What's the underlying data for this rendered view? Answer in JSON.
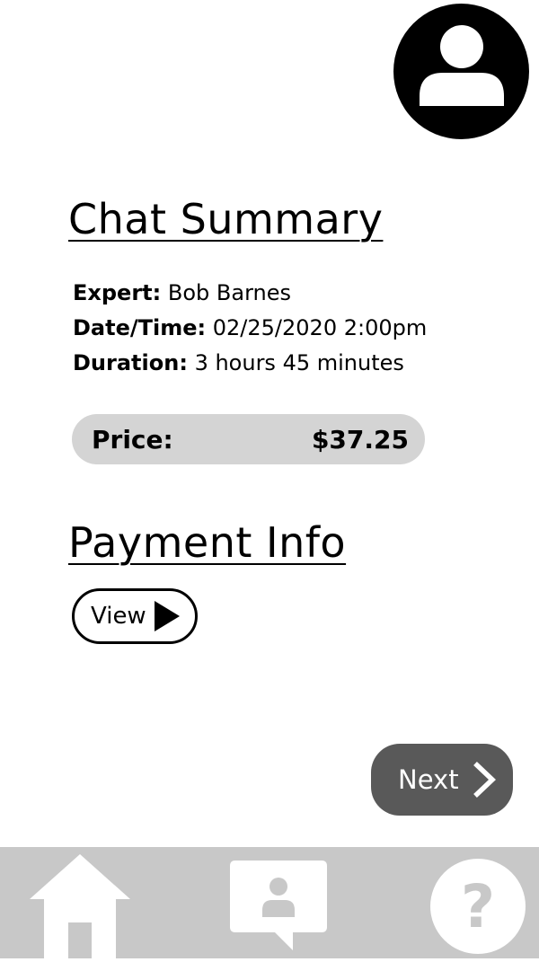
{
  "header": {
    "profile_icon": "user-avatar-icon"
  },
  "summary": {
    "title": "Chat Summary",
    "rows": [
      {
        "label": "Expert:",
        "value": "Bob Barnes"
      },
      {
        "label": "Date/Time:",
        "value": "02/25/2020 2:00pm"
      },
      {
        "label": "Duration:",
        "value": "3 hours 45 minutes"
      }
    ],
    "price": {
      "label": "Price:",
      "value": "$37.25"
    }
  },
  "payment": {
    "title": "Payment Info",
    "view_label": "View"
  },
  "next_label": "Next",
  "nav": {
    "items": [
      {
        "icon": "home-icon"
      },
      {
        "icon": "chat-expert-icon"
      },
      {
        "icon": "help-icon"
      }
    ]
  },
  "colors": {
    "price_pill": "#d4d4d4",
    "next_button": "#595959",
    "nav_bar": "#c8c8c8"
  }
}
